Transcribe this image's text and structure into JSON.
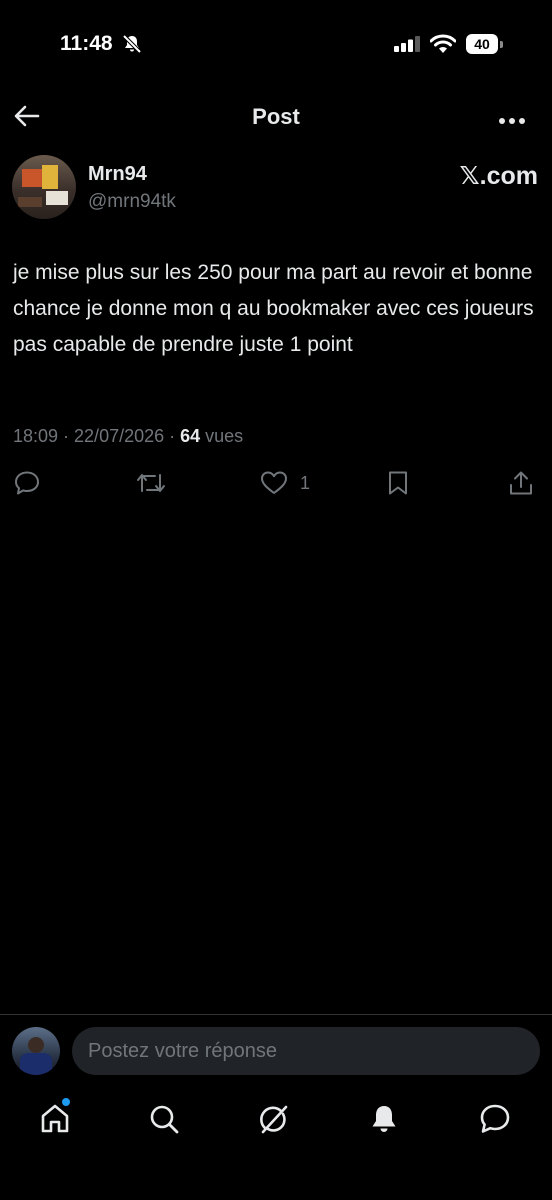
{
  "status_bar": {
    "time": "11:48",
    "battery": "40"
  },
  "header": {
    "title": "Post"
  },
  "author": {
    "display_name": "Mrn94",
    "handle": "@mrn94tk",
    "watermark": "𝕏.com"
  },
  "post": {
    "text": "je mise plus sur les 250 pour ma part au revoir et bonne chance je donne mon q au bookmaker avec ces joueurs pas capable de prendre juste 1 point",
    "timestamp": "18:09 · 22/07/2026 · ",
    "views_count": "64",
    "views_label": " vues"
  },
  "actions": {
    "likes_count": "1"
  },
  "reply": {
    "placeholder": "Postez votre réponse"
  },
  "icons": {
    "back": "arrow-left-icon",
    "more": "more-horizontal-icon",
    "reply": "speech-bubble-icon",
    "repost": "repost-icon",
    "like": "heart-icon",
    "bookmark": "bookmark-icon",
    "share": "share-icon",
    "home": "home-icon",
    "search": "search-icon",
    "grok": "slash-circle-icon",
    "notifications": "bell-icon",
    "messages": "message-icon"
  },
  "colors": {
    "background": "#000000",
    "text": "#e7e9ea",
    "muted": "#71767b",
    "accent": "#1d9bf0"
  }
}
